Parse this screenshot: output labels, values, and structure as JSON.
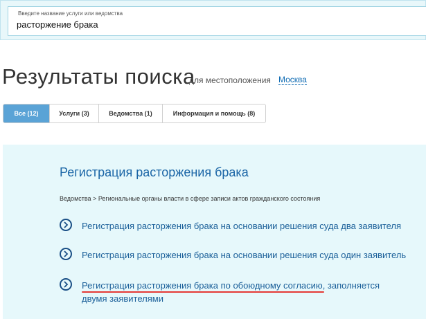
{
  "search": {
    "label": "Введите название услуги или ведомства",
    "value": "расторжение брака"
  },
  "results": {
    "title": "Результаты поиска",
    "location_label": "для местоположения",
    "location": "Москва"
  },
  "tabs": [
    {
      "label": "Все (12)",
      "active": true
    },
    {
      "label": "Услуги (3)",
      "active": false
    },
    {
      "label": "Ведомства (1)",
      "active": false
    },
    {
      "label": "Информация и помощь (8)",
      "active": false
    }
  ],
  "group": {
    "title": "Регистрация расторжения брака",
    "breadcrumb": "Ведомства > Региональные органы власти в сфере записи актов гражданского состояния"
  },
  "services": [
    {
      "link": "Регистрация расторжения брака на основании решения суда два заявителя"
    },
    {
      "link": "Регистрация расторжения брака на основании решения суда один заявитель"
    },
    {
      "link": "Регистрация расторжения брака по обоюдному согласию",
      "suffix": ", заполняется двумя заявителями"
    }
  ],
  "colors": {
    "accent": "#5aa3d6",
    "link": "#1a5f99",
    "panel_bg": "#e6f8fb",
    "highlight": "#e53935"
  }
}
